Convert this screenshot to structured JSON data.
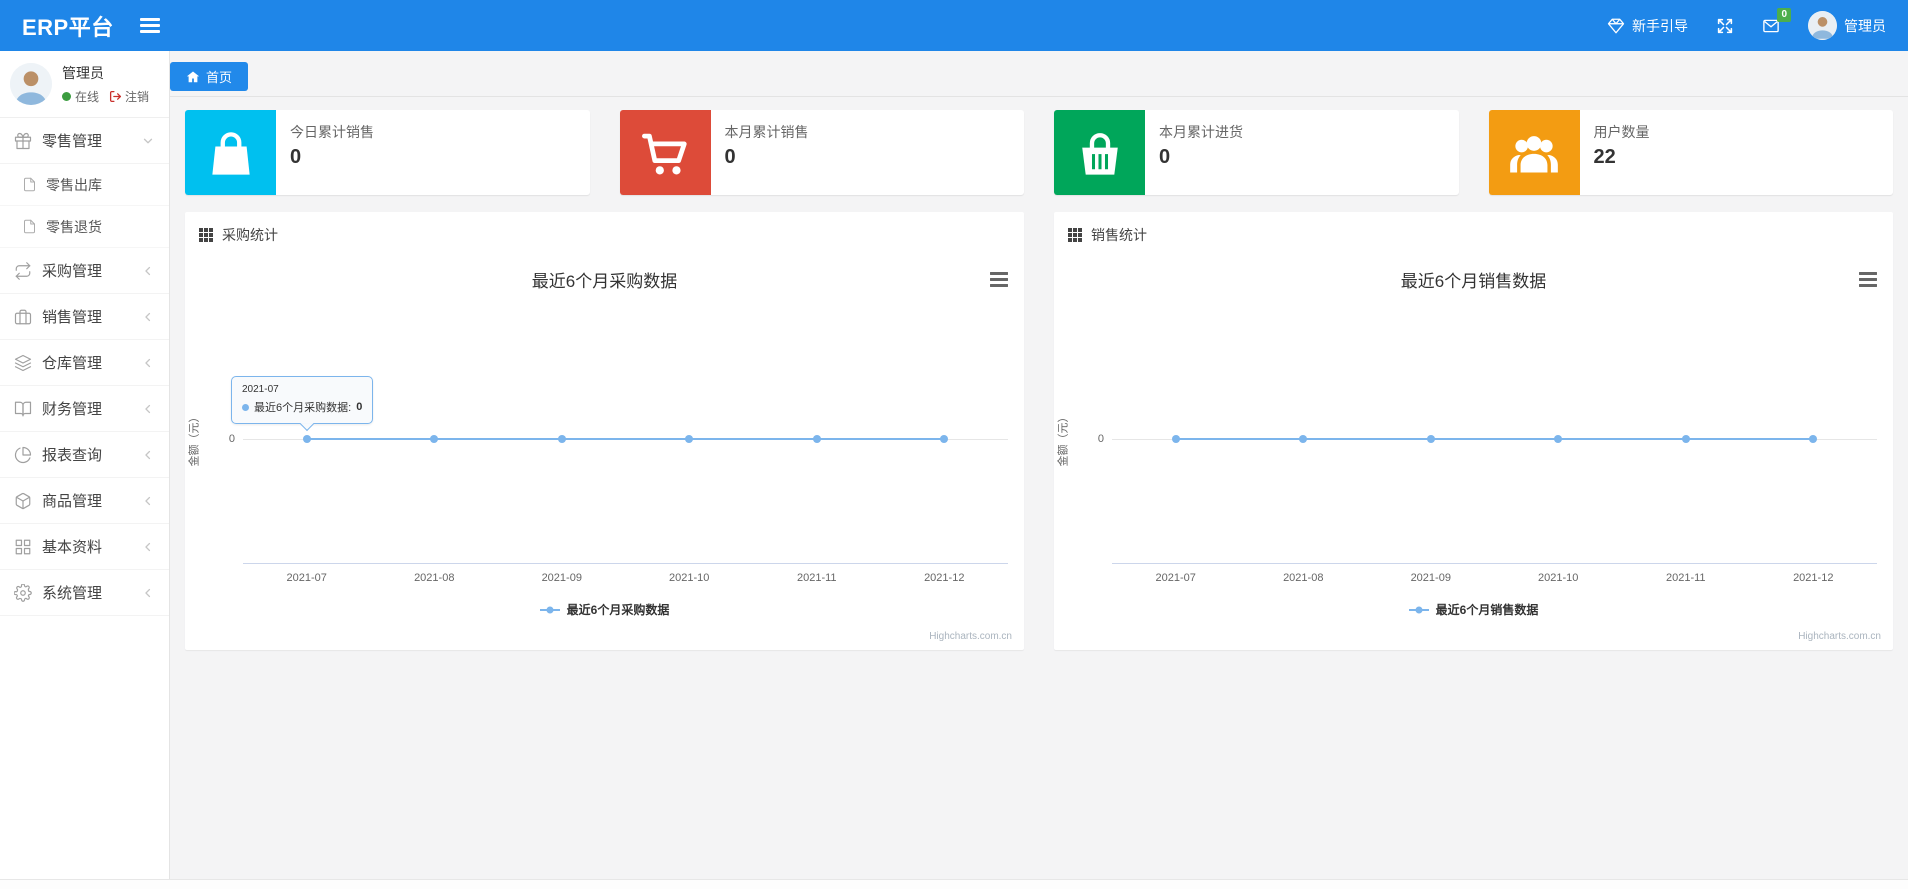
{
  "navbar": {
    "brand": "ERP平台",
    "guide_label": "新手引导",
    "badge_count": "0",
    "user_name": "管理员"
  },
  "sidebar": {
    "user_name": "管理员",
    "status_label": "在线",
    "logout_label": "注销",
    "menu": [
      {
        "id": "retail",
        "label": "零售管理",
        "icon": "gift-icon",
        "state": "expanded",
        "children": [
          {
            "id": "retail-out",
            "label": "零售出库",
            "icon": "file-icon"
          },
          {
            "id": "retail-return",
            "label": "零售退货",
            "icon": "file-icon"
          }
        ]
      },
      {
        "id": "purchase",
        "label": "采购管理",
        "icon": "repeat-icon",
        "state": "collapsed"
      },
      {
        "id": "sales",
        "label": "销售管理",
        "icon": "briefcase-icon",
        "state": "collapsed"
      },
      {
        "id": "warehouse",
        "label": "仓库管理",
        "icon": "layers-icon",
        "state": "collapsed"
      },
      {
        "id": "finance",
        "label": "财务管理",
        "icon": "book-icon",
        "state": "collapsed"
      },
      {
        "id": "report",
        "label": "报表查询",
        "icon": "pie-chart-icon",
        "state": "collapsed"
      },
      {
        "id": "goods",
        "label": "商品管理",
        "icon": "package-icon",
        "state": "collapsed"
      },
      {
        "id": "basic",
        "label": "基本资料",
        "icon": "grid-icon",
        "state": "collapsed"
      },
      {
        "id": "system",
        "label": "系统管理",
        "icon": "gear-icon",
        "state": "collapsed"
      }
    ]
  },
  "tabs": [
    {
      "label": "首页",
      "icon": "home-icon",
      "active": true
    }
  ],
  "stats": [
    {
      "label": "今日累计销售",
      "value": "0",
      "color": "#00c0ef",
      "icon": "shopping-bag-icon"
    },
    {
      "label": "本月累计销售",
      "value": "0",
      "color": "#dd4b39",
      "icon": "shopping-cart-icon"
    },
    {
      "label": "本月累计进货",
      "value": "0",
      "color": "#00a65a",
      "icon": "shopping-basket-icon"
    },
    {
      "label": "用户数量",
      "value": "22",
      "color": "#f39c12",
      "icon": "users-icon"
    }
  ],
  "chart_data": [
    {
      "type": "line",
      "panel_title": "采购统计",
      "title": "最近6个月采购数据",
      "categories": [
        "2021-07",
        "2021-08",
        "2021-09",
        "2021-10",
        "2021-11",
        "2021-12"
      ],
      "series": [
        {
          "name": "最近6个月采购数据",
          "values": [
            0,
            0,
            0,
            0,
            0,
            0
          ],
          "color": "#7cb5ec"
        }
      ],
      "ylabel": "金额（元）",
      "y_tick": "0",
      "grid": "off",
      "legend_position": "bottom",
      "watermark": "Highcharts.com.cn",
      "tooltip": {
        "visible": true,
        "header": "2021-07",
        "series_name": "最近6个月采购数据",
        "separator": ": ",
        "value": "0"
      }
    },
    {
      "type": "line",
      "panel_title": "销售统计",
      "title": "最近6个月销售数据",
      "categories": [
        "2021-07",
        "2021-08",
        "2021-09",
        "2021-10",
        "2021-11",
        "2021-12"
      ],
      "series": [
        {
          "name": "最近6个月销售数据",
          "values": [
            0,
            0,
            0,
            0,
            0,
            0
          ],
          "color": "#7cb5ec"
        }
      ],
      "ylabel": "金额（元）",
      "y_tick": "0",
      "grid": "off",
      "legend_position": "bottom",
      "watermark": "Highcharts.com.cn",
      "tooltip": {
        "visible": false
      }
    }
  ]
}
